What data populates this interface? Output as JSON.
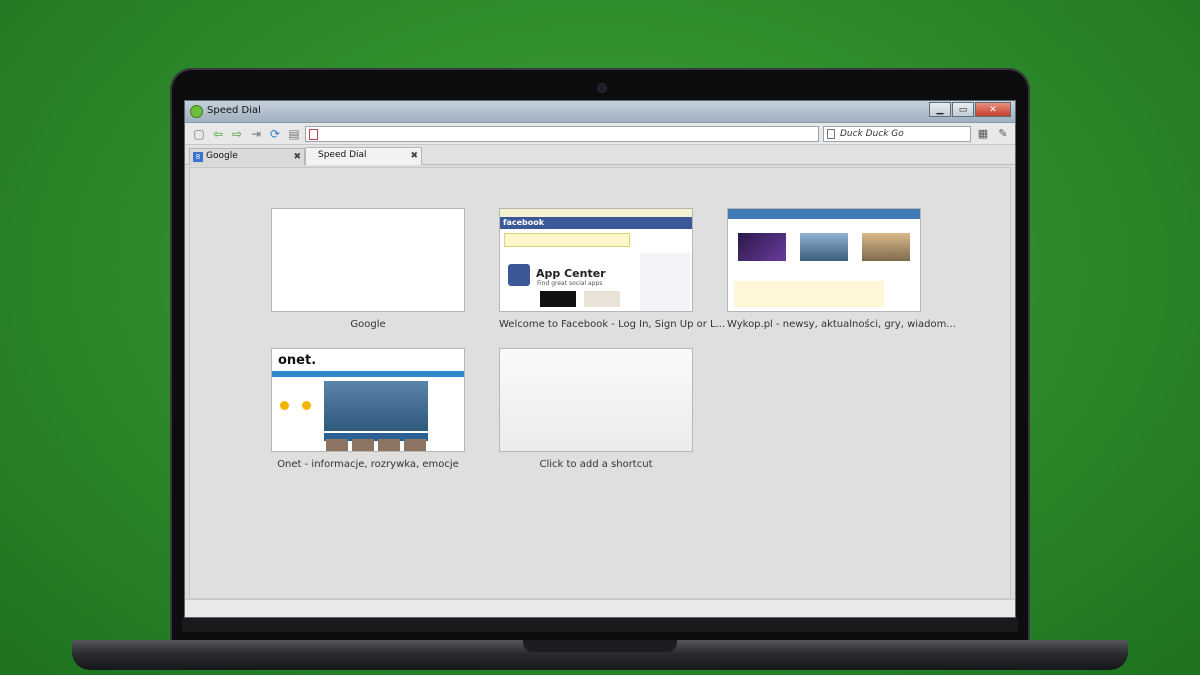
{
  "window": {
    "title": "Speed Dial",
    "controls": {
      "minimize": "▁",
      "maximize": "▭",
      "close": "✕"
    }
  },
  "toolbar": {
    "icons": [
      "new-page-icon",
      "back-icon",
      "forward-icon",
      "stop-icon",
      "reload-icon",
      "history-icon"
    ],
    "address": "",
    "search_placeholder": "Duck Duck Go"
  },
  "tabs": [
    {
      "label": "Google",
      "active": false,
      "close": "✖"
    },
    {
      "label": "Speed Dial",
      "active": true,
      "close": "✖"
    }
  ],
  "speed_dial": [
    {
      "label": "Google",
      "kind": "google"
    },
    {
      "label": "Welcome to Facebook - Log In, Sign Up or L...",
      "kind": "facebook"
    },
    {
      "label": "Wykop.pl - newsy, aktualności, gry, wiadom...",
      "kind": "wykop"
    },
    {
      "label": "Onet - informacje, rozrywka, emocje",
      "kind": "onet"
    },
    {
      "label": "Click to add a shortcut",
      "kind": "empty"
    }
  ],
  "thumb_text": {
    "facebook_logo": "facebook",
    "facebook_app": "App Center",
    "facebook_app_sub": "Find great social apps",
    "onet_logo": "onet."
  },
  "colors": {
    "facebook_blue": "#3b5998",
    "wykop_blue": "#3f79b6",
    "onet_blue": "#2f86c8"
  }
}
